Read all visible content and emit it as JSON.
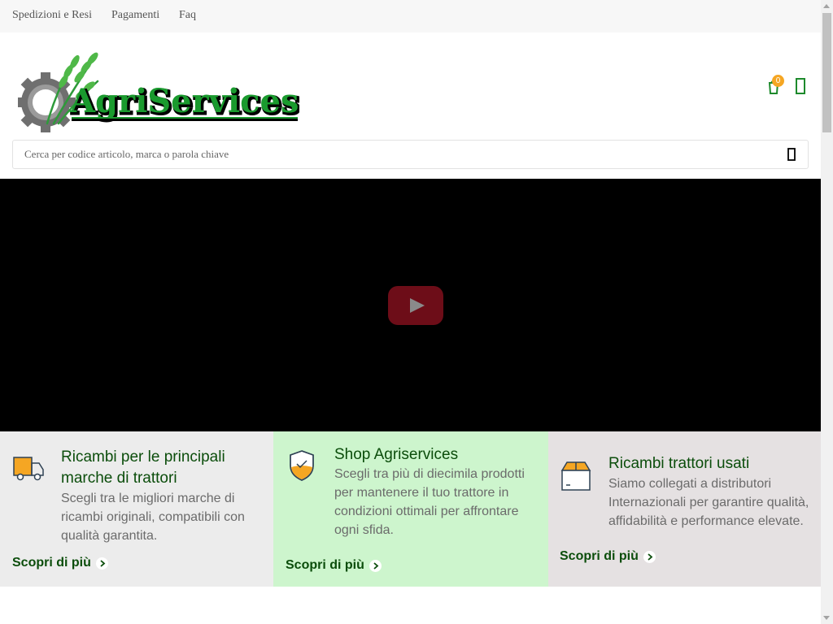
{
  "topbar": {
    "links": [
      "Spedizioni e Resi",
      "Pagamenti",
      "Faq"
    ]
  },
  "header": {
    "logo_text": "AgriServices",
    "cart_count": "0",
    "icons": [
      "cart-icon",
      "user-icon",
      "search-icon"
    ]
  },
  "search": {
    "placeholder": "Cerca per codice articolo, marca o parola chiave"
  },
  "video": {
    "play_icon": "youtube-play-icon"
  },
  "features": [
    {
      "icon": "truck-icon",
      "title": "Ricambi per le principali marche di trattori",
      "text": "Scegli tra le migliori marche di ricambi originali, compatibili con qualità garantita.",
      "link": "Scopri di più"
    },
    {
      "icon": "shield-check-icon",
      "title": "Shop Agriservices",
      "text": "Scegli tra più di diecimila prodotti per mantenere il tuo trattore in condizioni ottimali per affrontare ogni sfida.",
      "link": "Scopri di più"
    },
    {
      "icon": "box-icon",
      "title": "Ricambi trattori usati",
      "text": "Siamo collegati a distributori Internazionali per garantire qualità, affidabilità e performance elevate.",
      "link": "Scopri di più"
    }
  ],
  "colors": {
    "brand_green": "#0b4d0b",
    "logo_green": "#1a9a2e",
    "accent_orange": "#f5a623",
    "card1_bg": "#ececec",
    "card2_bg": "#cdf5cd",
    "card3_bg": "#e5e1e2"
  }
}
